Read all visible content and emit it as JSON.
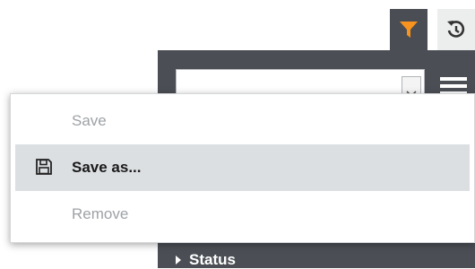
{
  "toolbar": {
    "filter_icon": "filter-icon",
    "filter_color": "#f7931e",
    "history_icon": "history-icon"
  },
  "panel": {
    "status_label": "Status"
  },
  "menu": {
    "items": [
      {
        "label": "Save",
        "state": "disabled"
      },
      {
        "label": "Save as...",
        "state": "highlighted",
        "icon": "floppy-disk-icon"
      },
      {
        "label": "Remove",
        "state": "disabled"
      }
    ]
  }
}
